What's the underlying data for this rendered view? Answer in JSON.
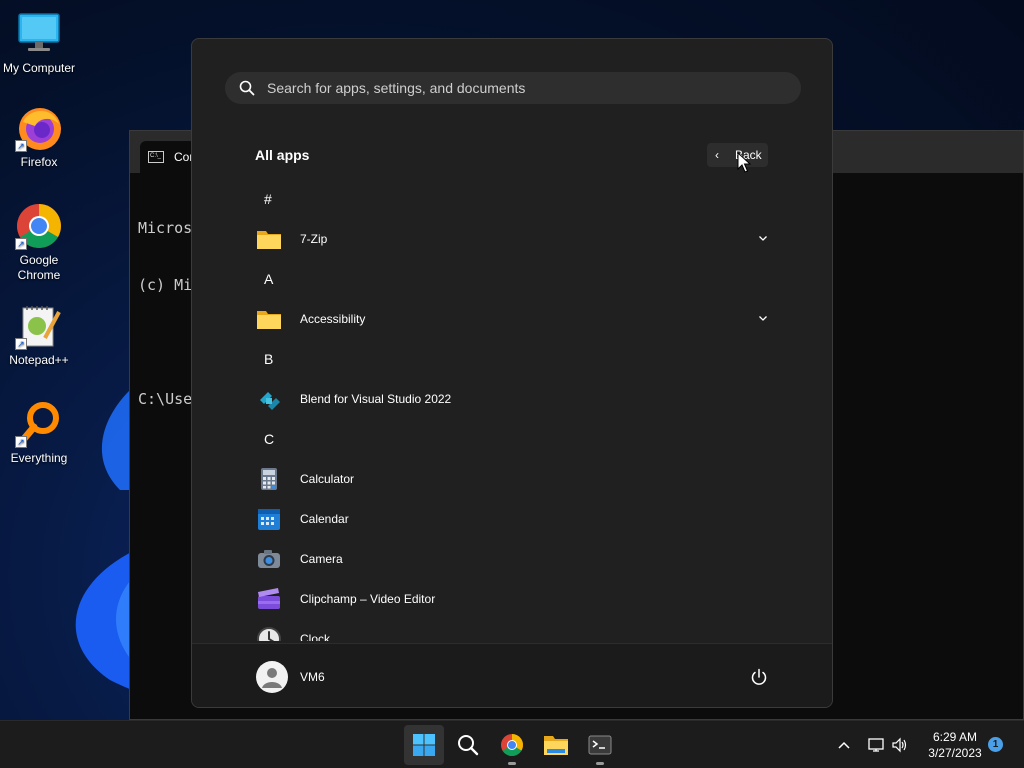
{
  "desktop": {
    "icons": [
      {
        "label": "My Computer",
        "icon": "monitor-icon"
      },
      {
        "label": "Firefox",
        "icon": "firefox-icon"
      },
      {
        "label": "Google Chrome",
        "icon": "chrome-icon"
      },
      {
        "label": "Notepad++",
        "icon": "notepadpp-icon"
      },
      {
        "label": "Everything",
        "icon": "magnifier-icon"
      }
    ]
  },
  "console": {
    "tab_label": "Cor",
    "tab_icon_text": "C:\\_",
    "lines": [
      "Micros",
      "(c) Mi",
      "",
      "C:\\Use"
    ]
  },
  "start_menu": {
    "search": {
      "placeholder": "Search for apps, settings, and documents",
      "value": ""
    },
    "title": "All apps",
    "back_label": "Back",
    "entries": [
      {
        "kind": "header",
        "text": "#"
      },
      {
        "kind": "app",
        "name": "7-Zip",
        "icon": "folder-icon",
        "expandable": true
      },
      {
        "kind": "header",
        "text": "A"
      },
      {
        "kind": "app",
        "name": "Accessibility",
        "icon": "folder-icon",
        "expandable": true
      },
      {
        "kind": "header",
        "text": "B"
      },
      {
        "kind": "app",
        "name": "Blend for Visual Studio 2022",
        "icon": "blend-icon",
        "expandable": false
      },
      {
        "kind": "header",
        "text": "C"
      },
      {
        "kind": "app",
        "name": "Calculator",
        "icon": "calculator-icon",
        "expandable": false
      },
      {
        "kind": "app",
        "name": "Calendar",
        "icon": "calendar-icon",
        "expandable": false
      },
      {
        "kind": "app",
        "name": "Camera",
        "icon": "camera-icon",
        "expandable": false
      },
      {
        "kind": "app",
        "name": "Clipchamp – Video Editor",
        "icon": "clipchamp-icon",
        "expandable": false
      },
      {
        "kind": "app",
        "name": "Clock",
        "icon": "clock-icon",
        "expandable": false
      }
    ],
    "user": {
      "name": "VM6"
    },
    "power_icon": "power-icon"
  },
  "taskbar": {
    "apps": [
      "start-icon",
      "search-icon",
      "chrome-icon",
      "file-explorer-icon",
      "terminal-icon"
    ],
    "tray": [
      "chevron-up-icon",
      "network-icon",
      "volume-icon"
    ],
    "time": "6:29 AM",
    "date": "3/27/2023",
    "notification_count": "1"
  },
  "colors": {
    "start_bg": "#202020",
    "accent": "#4aa0e8",
    "taskbar_bg": "#1c1c1c"
  }
}
